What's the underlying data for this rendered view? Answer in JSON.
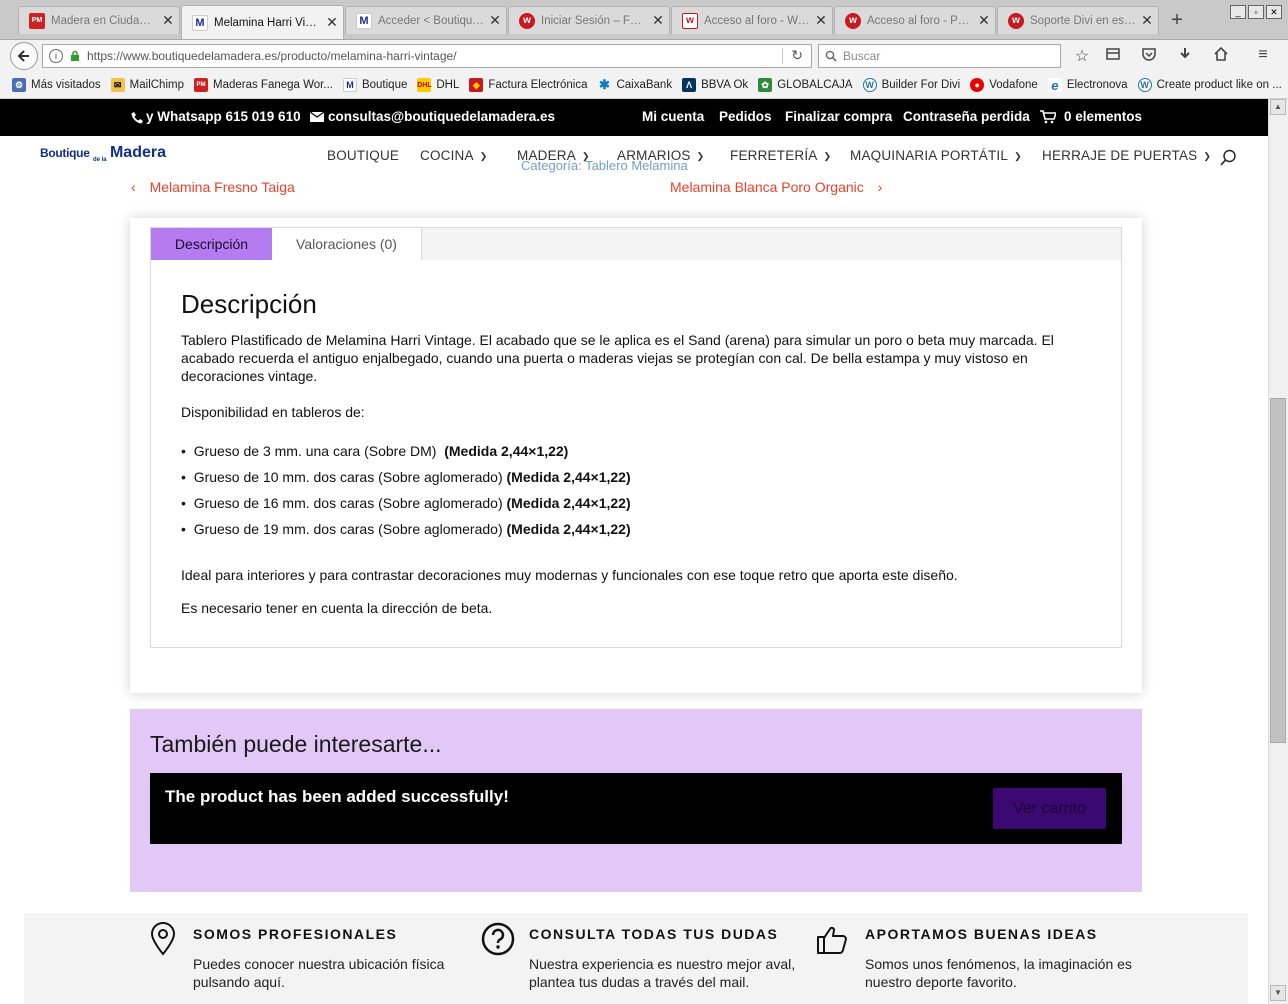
{
  "browser": {
    "tabs": [
      {
        "title": "Madera en Ciudad R...",
        "icon": "pm-favicon"
      },
      {
        "title": "Melamina Harri Vinta...",
        "icon": "m-favicon",
        "active": true
      },
      {
        "title": "Acceder < Boutique ...",
        "icon": "m-favicon"
      },
      {
        "title": "Iniciar Sesión – Foro ...",
        "icon": "w-favicon"
      },
      {
        "title": "Acceso al foro - We...",
        "icon": "w-favicon"
      },
      {
        "title": "Acceso al foro - Pre...",
        "icon": "w-favicon"
      },
      {
        "title": "Soporte Divi en esp...",
        "icon": "w-favicon"
      }
    ],
    "new_tab": "+",
    "window_controls": [
      "_",
      "▫",
      "✕"
    ],
    "url": "https://www.boutiquedelamadera.es/producto/melamina-harri-vintage/",
    "search_placeholder": "Buscar",
    "bookmarks": [
      {
        "label": "Más visitados",
        "icon": "gear-icon"
      },
      {
        "label": "MailChimp",
        "icon": "mailchimp-icon"
      },
      {
        "label": "Maderas Fanega Wor...",
        "icon": "pm-icon"
      },
      {
        "label": "Boutique",
        "icon": "m-icon"
      },
      {
        "label": "DHL",
        "icon": "dhl-icon"
      },
      {
        "label": "Factura Electrónica",
        "icon": "shield-icon"
      },
      {
        "label": "CaixaBank",
        "icon": "star-icon"
      },
      {
        "label": "BBVA Ok",
        "icon": "bbva-icon"
      },
      {
        "label": "GLOBALCAJA",
        "icon": "globalcaja-icon"
      },
      {
        "label": "Builder For Divi",
        "icon": "wordpress-icon"
      },
      {
        "label": "Vodafone",
        "icon": "vodafone-icon"
      },
      {
        "label": "Electronova",
        "icon": "ie-icon"
      },
      {
        "label": "Create product like on ...",
        "icon": "wordpress-icon"
      }
    ]
  },
  "topbar": {
    "phone": "y Whatsapp 615 019 610",
    "email": "consultas@boutiquedelamadera.es",
    "links": [
      "Mi cuenta",
      "Pedidos",
      "Finalizar compra",
      "Contraseña perdida"
    ],
    "cart": "0 elementos"
  },
  "header": {
    "logo_line1": "Boutique",
    "logo_small": "de la",
    "logo_line2": "Madera",
    "menu": [
      "BOUTIQUE",
      "COCINA",
      "MADERA",
      "ARMARIOS",
      "FERRETERÍA",
      "MAQUINARIA PORTÁTIL",
      "HERRAJE DE PUERTAS"
    ],
    "category": "Categoría: Tablero Melamina"
  },
  "postnav": {
    "prev": "Melamina Fresno Taiga",
    "next": "Melamina Blanca Poro Organic",
    "prev_arrow": "‹",
    "next_arrow": "›"
  },
  "product_tabs": {
    "tabs": [
      "Descripción",
      "Valoraciones (0)"
    ],
    "heading": "Descripción",
    "paragraph1": "Tablero Plastificado de Melamina Harri Vintage. El acabado que se le aplica es el Sand (arena) para simular un poro o beta muy marcada. El acabado recuerda el antiguo enjalbegado, cuando una puerta o maderas viejas se protegían con cal. De bella estampa y muy vistoso en decoraciones vintage.",
    "availability": "Disponibilidad en tableros de:",
    "items": [
      {
        "text": "Grueso de 3 mm. una cara (Sobre DM)",
        "bold": "(Medida 2,44×1,22)"
      },
      {
        "text": "Grueso de 10 mm. dos caras (Sobre aglomerado)",
        "bold": "(Medida 2,44×1,22)"
      },
      {
        "text": "Grueso de 16 mm. dos caras (Sobre aglomerado)",
        "bold": "(Medida 2,44×1,22)"
      },
      {
        "text": "Grueso de 19 mm. dos caras (Sobre aglomerado)",
        "bold": "(Medida 2,44×1,22)"
      }
    ],
    "paragraph2": "Ideal para interiores y para contrastar decoraciones muy modernas y funcionales con ese toque retro que aporta este diseño.",
    "paragraph3": "Es necesario tener en cuenta la dirección de beta."
  },
  "related": {
    "heading": "También puede interesarte...",
    "notice": "The product has been added successfully!",
    "button": "Ver carrito"
  },
  "features": [
    {
      "title": "SOMOS PROFESIONALES",
      "text": "Puedes conocer nuestra ubicación física pulsando aquí.",
      "icon": "location-pin-icon"
    },
    {
      "title": "CONSULTA TODAS TUS DUDAS",
      "text": "Nuestra experiencia es nuestro mejor aval, plantea tus dudas a través del mail.",
      "icon": "question-icon"
    },
    {
      "title": "APORTAMOS BUENAS IDEAS",
      "text": "Somos unos fenómenos, la imaginación es nuestro deporte favorito.",
      "icon": "thumbs-up-icon"
    }
  ],
  "colors": {
    "accent_purple": "#b57cf0",
    "related_bg": "#e2c8f7",
    "link_red": "#e8412b",
    "button_purple": "#3c0973"
  }
}
